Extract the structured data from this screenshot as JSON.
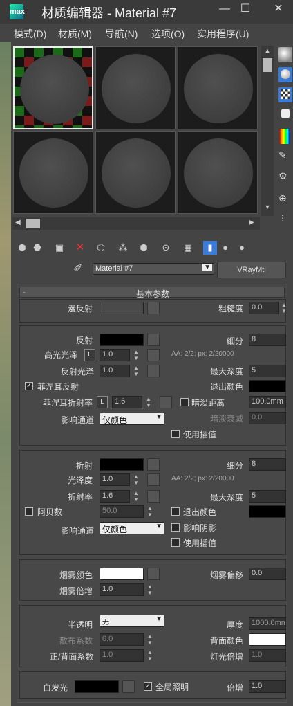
{
  "window": {
    "title": "材质编辑器 - Material #7",
    "logo_text": "max",
    "minimize": "—",
    "maximize": "☐",
    "close": "✕"
  },
  "menu": [
    "模式(D)",
    "材质(M)",
    "导航(N)",
    "选项(O)",
    "实用程序(U)"
  ],
  "toolbar": {
    "material_name": "Material #7",
    "material_type": "VRayMtl"
  },
  "rollout_title": "基本参数",
  "rollout_collapse": "-",
  "diffuse": {
    "label": "漫反射",
    "roughness_label": "粗糙度",
    "roughness": "0.0"
  },
  "reflection": {
    "label": "反射",
    "subdivs_label": "细分",
    "subdivs": "8",
    "hilight_label": "高光光泽",
    "hilight_lock": "L",
    "hilight": "1.0",
    "aa_info": "AA: 2/2; px: 2/20000",
    "gloss_label": "反射光泽",
    "gloss": "1.0",
    "maxdepth_label": "最大深度",
    "maxdepth": "5",
    "fresnel_label": "菲涅耳反射",
    "fresnel_checked": true,
    "exit_label": "退出颜色",
    "fresnel_ior_label": "菲涅耳折射率",
    "fresnel_ior_lock": "L",
    "fresnel_ior": "1.6",
    "dim_dist_label": "暗淡距离",
    "dim_dist": "100.0mm",
    "affect_label": "影响通道",
    "affect_value": "仅颜色",
    "dim_falloff_label": "暗淡衰减",
    "dim_falloff": "0.0",
    "interp_label": "使用插值"
  },
  "refraction": {
    "label": "折射",
    "subdivs_label": "细分",
    "subdivs": "8",
    "gloss_label": "光泽度",
    "gloss": "1.0",
    "aa_info": "AA: 2/2; px: 2/20000",
    "ior_label": "折射率",
    "ior": "1.6",
    "maxdepth_label": "最大深度",
    "maxdepth": "5",
    "abbe_label": "阿贝数",
    "abbe": "50.0",
    "exit_label": "退出颜色",
    "affect_label": "影响通道",
    "affect_value": "仅颜色",
    "shadows_label": "影响阴影",
    "interp_label": "使用插值"
  },
  "fog": {
    "color_label": "烟雾颜色",
    "bias_label": "烟雾偏移",
    "bias": "0.0",
    "mult_label": "烟雾倍增",
    "mult": "1.0"
  },
  "translucency": {
    "label": "半透明",
    "value": "无",
    "thickness_label": "厚度",
    "thickness": "1000.0mm",
    "scatter_label": "散布系数",
    "scatter": "0.0",
    "back_label": "背面颜色",
    "fb_label": "正/背面系数",
    "fb": "1.0",
    "light_label": "灯光倍增",
    "light": "1.0"
  },
  "selfillum": {
    "label": "自发光",
    "gi_label": "全局照明",
    "gi_checked": true,
    "mult_label": "倍增",
    "mult": "1.0"
  },
  "colors": {
    "black": "#000000",
    "white": "#ffffff",
    "gray_swatch": "#4a4a4a",
    "accent_blue": "#3a7bd5"
  }
}
